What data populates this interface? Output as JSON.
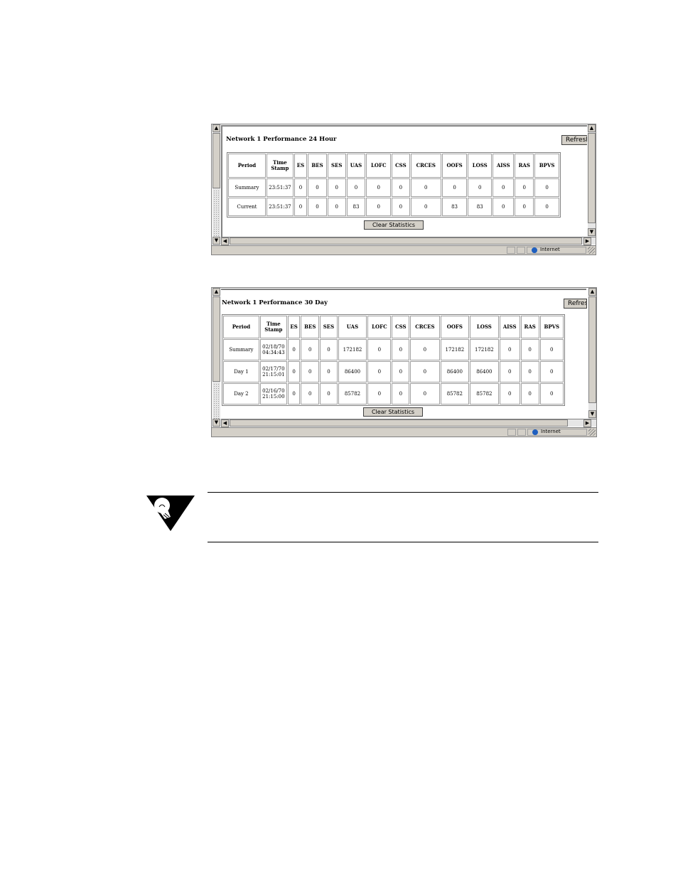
{
  "windows": [
    {
      "title": "Network 1 Performance 24 Hour",
      "refresh_label": "Refresh",
      "clear_label": "Clear Statistics",
      "status_zone": "Internet",
      "headers": [
        "Period",
        "Time Stamp",
        "ES",
        "BES",
        "SES",
        "UAS",
        "LOFC",
        "CSS",
        "CRCES",
        "OOFS",
        "LOSS",
        "AISS",
        "RAS",
        "BPVS"
      ],
      "rows": [
        [
          "Summary",
          "23:51:37",
          "0",
          "0",
          "0",
          "0",
          "0",
          "0",
          "0",
          "0",
          "0",
          "0",
          "0",
          "0"
        ],
        [
          "Current",
          "23:51:37",
          "0",
          "0",
          "0",
          "83",
          "0",
          "0",
          "0",
          "83",
          "83",
          "0",
          "0",
          "0"
        ]
      ]
    },
    {
      "title": "Network 1 Performance 30 Day",
      "refresh_label": "Refresh",
      "clear_label": "Clear Statistics",
      "status_zone": "Internet",
      "headers": [
        "Period",
        "Time Stamp",
        "ES",
        "BES",
        "SES",
        "UAS",
        "LOFC",
        "CSS",
        "CRCES",
        "OOFS",
        "LOSS",
        "AISS",
        "RAS",
        "BPVS"
      ],
      "rows": [
        [
          "Summary",
          "02/18/70 04:34:43",
          "0",
          "0",
          "0",
          "172182",
          "0",
          "0",
          "0",
          "172182",
          "172182",
          "0",
          "0",
          "0"
        ],
        [
          "Day 1",
          "02/17/70 21:15:01",
          "0",
          "0",
          "0",
          "86400",
          "0",
          "0",
          "0",
          "86400",
          "86400",
          "0",
          "0",
          "0"
        ],
        [
          "Day 2",
          "02/16/70 21:15:00",
          "0",
          "0",
          "0",
          "85782",
          "0",
          "0",
          "0",
          "85782",
          "85782",
          "0",
          "0",
          "0"
        ]
      ]
    }
  ],
  "icons": {
    "note": "lightbulb-note-icon",
    "scroll_up": "arrow-up-icon",
    "scroll_down": "arrow-down-icon",
    "scroll_left": "arrow-left-icon",
    "scroll_right": "arrow-right-icon",
    "globe": "globe-icon"
  }
}
